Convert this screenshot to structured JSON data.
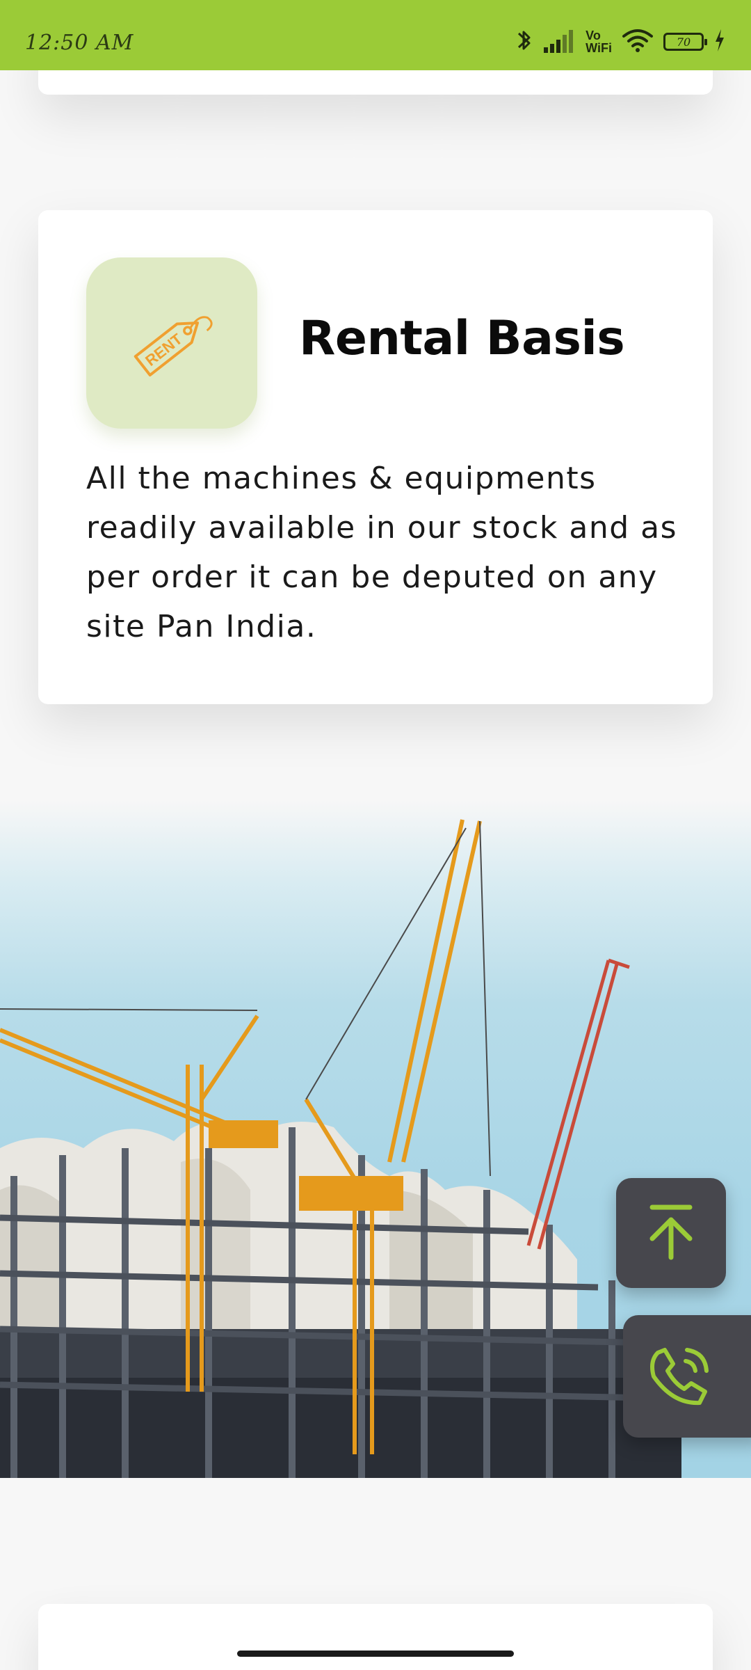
{
  "status_bar": {
    "time": "12:50 AM",
    "vowifi_top": "Vo",
    "vowifi_bottom": "WiFi",
    "battery": "70",
    "background_color": "#9bcb37"
  },
  "rental_card": {
    "icon": "rent-tag-icon",
    "icon_text": "RENT",
    "title": "Rental Basis",
    "description": "All the machines & equipments readily available in our stock and as per order it can be deputed on any site Pan India."
  },
  "hero": {
    "image": "construction-cranes-photo"
  },
  "fabs": {
    "scroll_top_icon": "arrow-up-to-top-icon",
    "call_icon": "phone-call-icon",
    "accent_color": "#9bcb37",
    "fab_color": "#47474d"
  }
}
